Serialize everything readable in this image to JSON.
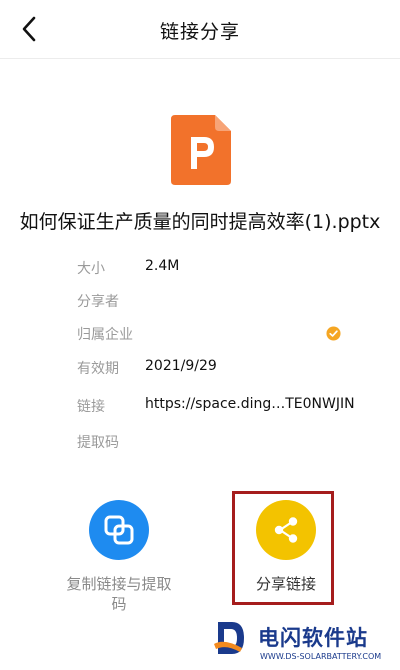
{
  "header": {
    "title": "链接分享",
    "back_icon": "back-arrow-icon"
  },
  "file": {
    "icon": "powerpoint-file-icon",
    "icon_color": "#f2722b",
    "name": "如何保证生产质量的同时提高效率(1).pptx"
  },
  "info": {
    "size": {
      "label": "大小",
      "value": "2.4M"
    },
    "sharer": {
      "label": "分享者",
      "value": ""
    },
    "company": {
      "label": "归属企业",
      "value": "",
      "badge_icon": "verified-icon",
      "badge_color": "#f5a623"
    },
    "expiry": {
      "label": "有效期",
      "value": "2021/9/29"
    },
    "link": {
      "label": "链接",
      "value": "https://space.ding…TE0NWJIN"
    },
    "code": {
      "label": "提取码",
      "value": ""
    }
  },
  "actions": {
    "copy": {
      "label": "复制链接与提取码",
      "icon": "copy-icon",
      "color": "#1e8bf0"
    },
    "share": {
      "label": "分享链接",
      "icon": "share-icon",
      "color": "#f3c300"
    }
  },
  "watermark": {
    "title": "电闪软件站",
    "url": "WWW.DS-SOLARBATTERY.COM"
  }
}
